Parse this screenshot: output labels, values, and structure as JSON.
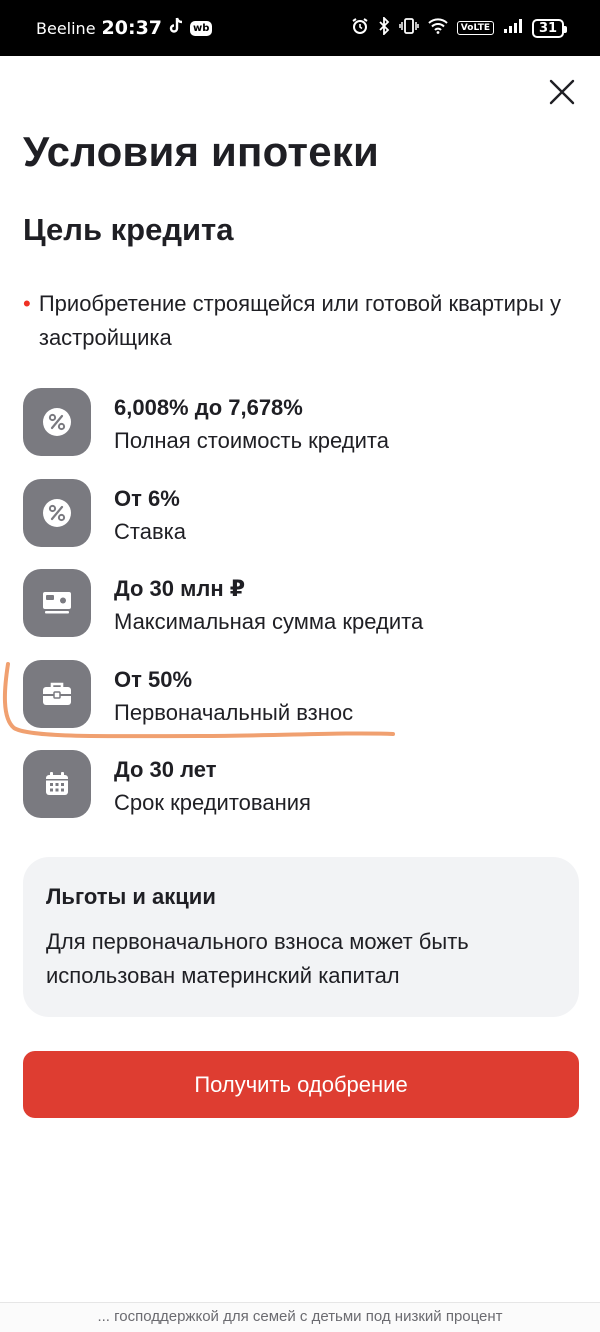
{
  "status_bar": {
    "carrier": "Beeline",
    "time": "20:37",
    "app_badge": "wb",
    "volte": "VoLTE",
    "battery": "31"
  },
  "header": {
    "title": "Условия ипотеки",
    "close_icon": "close-icon"
  },
  "purpose": {
    "title": "Цель кредита",
    "items": [
      "Приобретение строящейся или готовой квартиры у застройщика"
    ]
  },
  "conditions": [
    {
      "icon": "percent-icon",
      "value": "6,008% до 7,678%",
      "label": "Полная стоимость кредита"
    },
    {
      "icon": "percent-icon",
      "value": "От 6%",
      "label": "Ставка"
    },
    {
      "icon": "money-icon",
      "value": "До 30 млн ₽",
      "label": "Максимальная сумма кредита"
    },
    {
      "icon": "briefcase-icon",
      "value": "От 50%",
      "label": "Первоначальный взнос"
    },
    {
      "icon": "calendar-icon",
      "value": "До 30 лет",
      "label": "Срок кредитования"
    }
  ],
  "promo": {
    "title": "Льготы и акции",
    "text": "Для первоначального взноса может быть использован материнский капитал"
  },
  "action": {
    "label": "Получить одобрение"
  },
  "footer": {
    "text": "... господдержкой для семей с детьми под низкий процент"
  },
  "colors": {
    "accent": "#de3d31",
    "bullet": "#ef3124",
    "icon_bg": "#7a7a80",
    "promo_bg": "#f2f3f5",
    "annotation": "#f0a070"
  }
}
